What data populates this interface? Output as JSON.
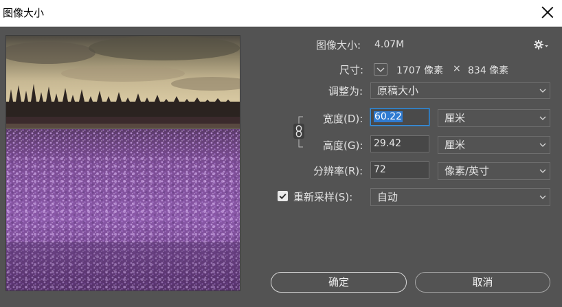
{
  "window": {
    "title": "图像大小"
  },
  "info": {
    "image_size_label": "图像大小:",
    "image_size_value": "4.07M",
    "dimensions_label": "尺寸:",
    "dimensions_width": "1707 像素",
    "dimensions_sep": "×",
    "dimensions_height": "834 像素"
  },
  "fit_to": {
    "label": "调整为:",
    "value": "原稿大小"
  },
  "width": {
    "label": "宽度(D):",
    "value": "60.22",
    "unit": "厘米"
  },
  "height": {
    "label": "高度(G):",
    "value": "29.42",
    "unit": "厘米"
  },
  "resolution": {
    "label": "分辨率(R):",
    "value": "72",
    "unit": "像素/英寸"
  },
  "resample": {
    "label": "重新采样(S):",
    "checked": true,
    "value": "自动"
  },
  "buttons": {
    "ok": "确定",
    "cancel": "取消"
  },
  "icons": {
    "close": "close-icon",
    "gear": "gear-icon",
    "chevron": "chevron-down-icon",
    "link": "link-chain-icon",
    "check": "checkmark-icon"
  },
  "colors": {
    "background": "#535353",
    "selection": "#2f7bd1",
    "focus_border": "#3b8fd9"
  }
}
